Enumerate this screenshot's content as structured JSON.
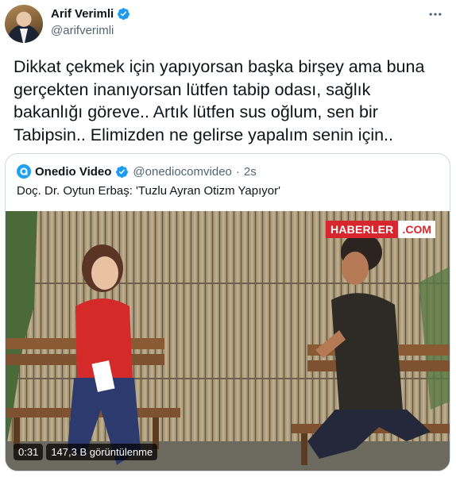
{
  "author": {
    "display_name": "Arif Verimli",
    "handle": "@arifverimli",
    "verified": true
  },
  "tweet": {
    "text": "Dikkat çekmek için yapıyorsan başka birşey ama buna\ngerçekten inanıyorsan lütfen tabip odası, sağlık\nbakanlığı göreve.. Artık lütfen sus oğlum, sen bir\nTabipsin.. Elimizden ne gelirse yapalım senin için.."
  },
  "quoted": {
    "display_name": "Onedio Video",
    "handle": "@onediocomvideo",
    "separator": "·",
    "time": "2s",
    "text": "Doç. Dr. Oytun Erbaş: 'Tuzlu Ayran Otizm Yapıyor'",
    "media": {
      "watermark_main": "HABERLER",
      "watermark_suffix": ".COM",
      "duration": "0:31",
      "views": "147,3 B görüntülenme"
    }
  },
  "icons": {
    "verified": "verified-badge-icon",
    "more": "more-options-icon",
    "quoted_avatar": "onedio-logo-icon"
  },
  "colors": {
    "verified_blue": "#1d9bf0",
    "secondary_text": "#536471",
    "brand_red": "#d8262e"
  }
}
